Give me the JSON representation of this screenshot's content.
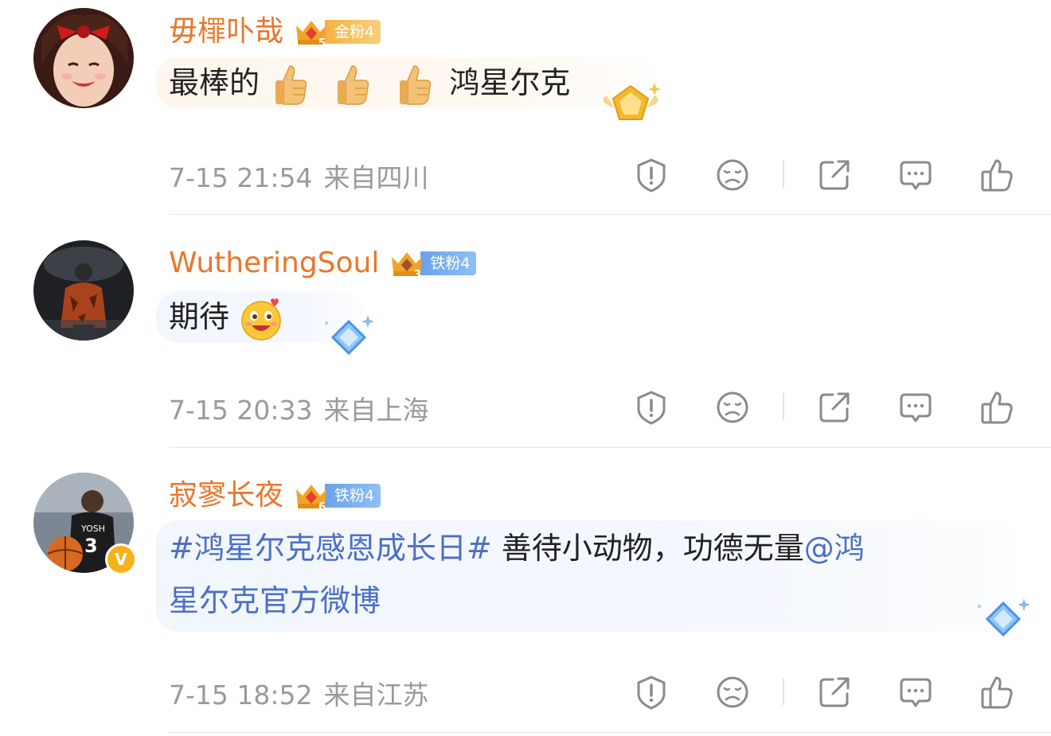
{
  "comments": [
    {
      "username": "毋檌卟哉",
      "fan_badge": {
        "level": "5",
        "label": "金粉4",
        "tone": "gold"
      },
      "text_before": "最棒的",
      "emoji_count": 3,
      "emoji": "thumbs-up",
      "text_after": "鸿星尔克",
      "time": "7-15 21:54",
      "location": "来自四川",
      "verified": false
    },
    {
      "username": "WutheringSoul",
      "fan_badge": {
        "level": "3",
        "label": "铁粉4",
        "tone": "iron"
      },
      "text_before": "期待",
      "emoji": "excited-face",
      "time": "7-15 20:33",
      "location": "来自上海",
      "verified": false
    },
    {
      "username": "寂寥长夜",
      "fan_badge": {
        "level": "6",
        "label": "铁粉4",
        "tone": "iron"
      },
      "hashtag": "#鸿星尔克感恩成长日#",
      "body_text": " 善待小动物，功德无量",
      "mention": "@鸿",
      "line2": "星尔克官方微博",
      "time": "7-15 18:52",
      "location": "来自江苏",
      "verified": true,
      "verified_mark": "V"
    }
  ],
  "actions": [
    "report-icon",
    "dislike-icon",
    "share-icon",
    "comment-icon",
    "like-icon"
  ],
  "colors": {
    "username": "#e9762b",
    "meta": "#9a9a9a",
    "link": "#4a6fc5",
    "icon": "#8a8a8a"
  }
}
